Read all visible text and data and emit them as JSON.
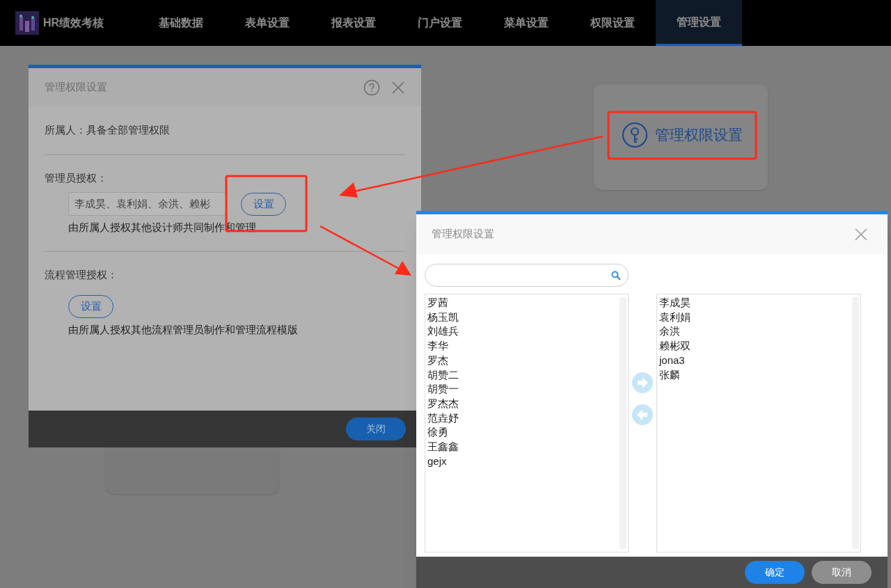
{
  "app": {
    "title": "HR绩效考核"
  },
  "nav": [
    {
      "label": "基础数据",
      "selected": false
    },
    {
      "label": "表单设置",
      "selected": false
    },
    {
      "label": "报表设置",
      "selected": false
    },
    {
      "label": "门户设置",
      "selected": false
    },
    {
      "label": "菜单设置",
      "selected": false
    },
    {
      "label": "权限设置",
      "selected": false
    },
    {
      "label": "管理设置",
      "selected": true
    }
  ],
  "card": {
    "label": "管理权限设置"
  },
  "owner_dialog": {
    "title": "管理权限设置",
    "owner_line": "所属人：具备全部管理权限",
    "sections": [
      {
        "label": "管理员授权：",
        "value": "李成昊、袁利娟、余洪、赖彬",
        "button": "设置",
        "note": "由所属人授权其他设计师共同制作和管理"
      },
      {
        "label": "流程管理授权：",
        "button": "设置",
        "note": "由所属人授权其他流程管理员制作和管理流程模版"
      }
    ],
    "close_button": "关闭"
  },
  "picker_dialog": {
    "title": "管理权限设置",
    "available": [
      "罗茜",
      "杨玉凯",
      "刘雄兵",
      "李华",
      "罗杰",
      "胡赞二",
      "胡赞一",
      "罗杰杰",
      "范垚妤",
      "徐勇",
      "王鑫鑫",
      "gejx"
    ],
    "chosen": [
      "李成昊",
      "袁利娟",
      "余洪",
      "赖彬双",
      "jona3",
      "张麟"
    ],
    "ok_button": "确定",
    "cancel_button": "取消"
  }
}
